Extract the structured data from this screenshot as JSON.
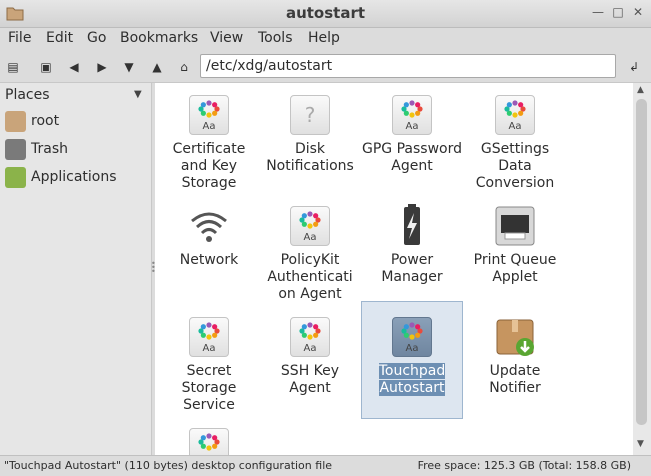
{
  "window": {
    "title": "autostart"
  },
  "menu": [
    "File",
    "Edit",
    "Go",
    "Bookmarks",
    "View",
    "Tools",
    "Help"
  ],
  "toolbar": {
    "path": "/etc/xdg/autostart"
  },
  "sidebar": {
    "header": "Places",
    "items": [
      {
        "label": "root",
        "icon": "home-folder-icon"
      },
      {
        "label": "Trash",
        "icon": "trash-icon"
      },
      {
        "label": "Applications",
        "icon": "applications-icon"
      }
    ]
  },
  "files": [
    {
      "name": "Certificate and Key Storage",
      "icon": "app-generic-icon"
    },
    {
      "name": "Disk Notifications",
      "icon": "unknown-icon"
    },
    {
      "name": "GPG Password Agent",
      "icon": "app-generic-icon"
    },
    {
      "name": "GSettings Data Conversion",
      "icon": "app-generic-icon"
    },
    {
      "name": "Network",
      "icon": "wifi-icon"
    },
    {
      "name": "PolicyKit Authenticati on Agent",
      "icon": "app-generic-icon"
    },
    {
      "name": "Power Manager",
      "icon": "battery-icon"
    },
    {
      "name": "Print Queue Applet",
      "icon": "printer-icon"
    },
    {
      "name": "Secret Storage Service",
      "icon": "app-generic-icon"
    },
    {
      "name": "SSH Key Agent",
      "icon": "app-generic-icon"
    },
    {
      "name": "Touchpad Autostart",
      "icon": "app-generic-icon",
      "selected": true
    },
    {
      "name": "Update Notifier",
      "icon": "package-update-icon"
    }
  ],
  "status": {
    "left": "\"Touchpad Autostart\" (110 bytes) desktop configuration file",
    "right": "Free space: 125.3 GB (Total: 158.8 GB)"
  },
  "colors": {
    "selection": "#6d8fb3",
    "selection_bg": "#dde6f0"
  }
}
